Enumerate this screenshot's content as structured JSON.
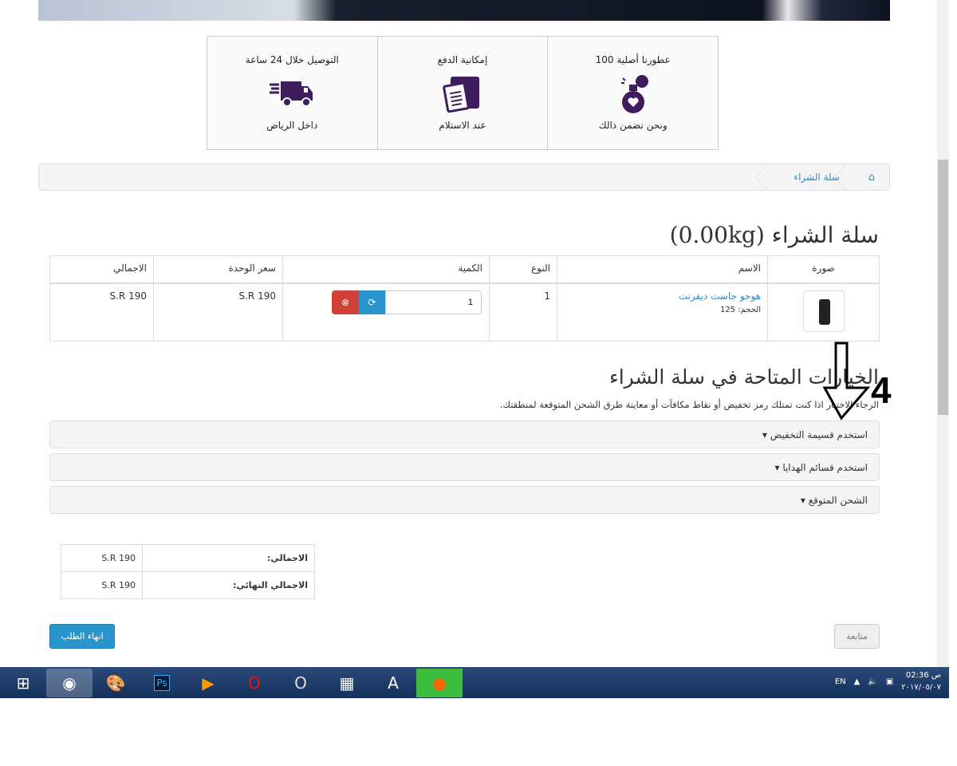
{
  "features": [
    {
      "title": "عطورنا أصلية 100",
      "subtitle": "ونحن نضمن ذالك",
      "icon": "perfume-icon"
    },
    {
      "title": "إمكانية الدفع",
      "subtitle": "عند الاستلام",
      "icon": "clipboard-box-icon"
    },
    {
      "title": "التوصيل خلال 24 ساعة",
      "subtitle": "داخل الرياض",
      "icon": "delivery-truck-icon"
    }
  ],
  "breadcrumb": {
    "home_icon": "home-icon",
    "current": "سلة الشراء"
  },
  "page_title": "سلة الشراء  (0.00kg)",
  "cart": {
    "headers": [
      "صورة",
      "الاسم",
      "النوع",
      "الكمية",
      "سعر الوحدة",
      "الاجمالي"
    ],
    "rows": [
      {
        "name": "هوجو جاست ديفرنت",
        "size": "الحجم: 125",
        "type": "1",
        "quantity": "1",
        "unit_price": "S.R 190",
        "total": "S.R 190"
      }
    ]
  },
  "options": {
    "title": "الخيارات المتاحة في سلة الشراء",
    "description": "الرجاء الاختيار اذا كنت تمتلك رمز تخفيض أو نقاط مكافآت أو معاينة طرق الشحن المتوقعة لمنطقتك.",
    "panels": [
      "استخدم قسيمة التخفيض",
      "استخدم قسائم الهدايا",
      "الشحن المتوقع"
    ]
  },
  "totals": [
    {
      "label": "الاجمالي:",
      "value": "S.R 190"
    },
    {
      "label": "الاجمالي النهائي:",
      "value": "S.R 190"
    }
  ],
  "buttons": {
    "checkout": "انهاء الطلب",
    "continue": "متابعة"
  },
  "annotation": {
    "number": "4"
  },
  "taskbar": {
    "lang": "EN",
    "time": "02:36 ص",
    "date": "٢٠١٧/٠٥/٠٧"
  },
  "colors": {
    "accent": "#2a94cc",
    "danger": "#d2403a",
    "icon_purple": "#3f1c5e"
  }
}
